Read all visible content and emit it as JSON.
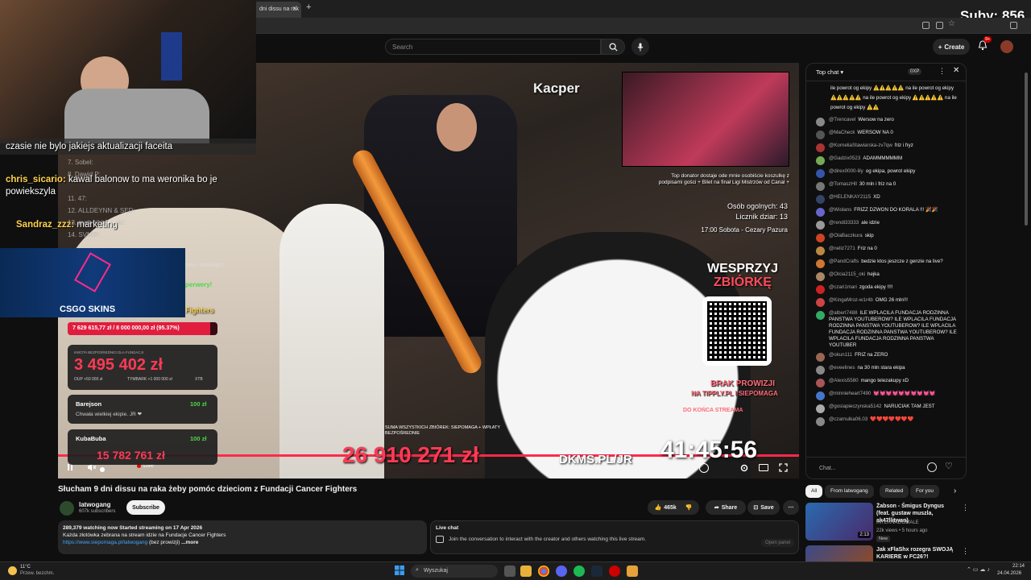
{
  "browser": {
    "tab_title": "dni dissu na rak",
    "new_tab": "+",
    "close_tab": "×"
  },
  "stream_overlay": {
    "subs_counter": "Suby: 856",
    "chat_line1": "czasie nie bylo jakiejs aktualizacji faceita",
    "chat2_user": "chris_sicario:",
    "chat2_msg": "kawal balonow to ma weronika bo je powiekszyla",
    "chat3_user": "Sandraz_zzz:",
    "chat3_msg": "marketing",
    "csgo_skins": "CSGO SKINS",
    "kacper_label": "Kacper",
    "fighters": "Fighters",
    "progress_text": "7 629 615,77 zł / 8 000 000,00 zł (95.37%)",
    "progress_fraction": 0.9537,
    "fund_label": "KWOTA BEZPOŚREDNIO DLA FUNDACJI",
    "fund_amount": "3 495 402 zł",
    "fund_sub1": "OUP +50 000 zł",
    "fund_sub2": "TYMBARK +1 000 000 zł",
    "fund_sub3": "XTB",
    "don1_user": "Barejson",
    "don1_amount": "100 zł",
    "don1_msg": "Chwała wielkiej ekipie. JR ❤",
    "don2_user": "KubaBuba",
    "don2_amount": "100 zł",
    "don2_total": "15 782 761 zł",
    "total_big": "26 910 271 zł",
    "total_caption": "SUMA WSZYSTKICH ZBIÓREK: SIEPOMAGA + WPŁATY BEZPOŚREDNIE",
    "dkms": "DKMS.PL/JR",
    "timer": "41:45:56",
    "timer_caption": "DO KOŃCA STREAMA",
    "top_donator": "Top donator dostaje ode mnie osobiście koszulkę z podpisami gości + Bilet na finał Ligi Mistrzów od Canal +",
    "people_total": "Osób ogolnych: 43",
    "gifts_counter": "Licznik dziar: 13",
    "saturday": "17:00 Sobota - Cezary Pazura",
    "wesprzyj": "WESPRZYJ",
    "zbiorke": "ZBIÓRKĘ",
    "brak_prowizji": "BRAK PROWIZJI",
    "tipply": "NA TIPPLY.PL I SIEPOMAGA",
    "ranks": [
      "7. Sobel:",
      "8. Dawid P:",
      "11. 47:",
      "12. ALLDEYNN & SED:",
      "13. matt gibbs + ski:",
      "14. SVMIR:"
    ],
    "live_label": "Live",
    "perwery": "perwery!",
    "rankingu": "celu i rankingu)"
  },
  "youtube": {
    "search_placeholder": "Search",
    "create_label": "Create",
    "notif_badge": "9+",
    "video_title": "Słucham 9 dni dissu na raka żeby pomóc dzieciom z Fundacji Cancer Fighters",
    "channel_name": "latwogang",
    "subscribers": "607k subscribers",
    "subscribe_label": "Subscribe",
    "likes": "465k",
    "share_label": "Share",
    "save_label": "Save",
    "desc_stats": "289,379 watching now  Started streaming on 17 Apr 2026",
    "desc_line1": "Każda złotówka zebrana na stream idzie na Fundacje Cancer Fighters",
    "desc_link": "https://www.siepomaga.pl/latwogang",
    "desc_rest": "(bez prowizji)",
    "desc_more": "...more",
    "live_chat_title": "Live chat",
    "live_chat_text": "Join the conversation to interact with the creator and others watching this live stream.",
    "open_panel": "Open panel"
  },
  "chat": {
    "header": "Top chat",
    "points": "0XP",
    "input_placeholder": "Chat...",
    "pinned_top": "ile powrot og ekipy ⚠️⚠️⚠️⚠️⚠️ na ile powrot og ekipy ⚠️⚠️⚠️⚠️⚠️ na ile powrot og ekipy ⚠️⚠️⚠️⚠️⚠️ na ile powrot og ekipy ⚠️⚠️",
    "messages": [
      {
        "user": "@Trencavel",
        "text": "Wersow na zero",
        "color": "#888"
      },
      {
        "user": "@MaCheck",
        "text": "WERSOW NA 0",
        "color": "#555"
      },
      {
        "user": "@KorneliaStawiarska-zv7qw",
        "text": "friz i fryz",
        "color": "#a33"
      },
      {
        "user": "@Gadzix0523",
        "text": "ADAMMMMMMM",
        "color": "#7a5"
      },
      {
        "user": "@direx0000-lily",
        "text": "og ekipa, powrot ekipy",
        "color": "#35a"
      },
      {
        "user": "@TomaszHll",
        "text": "30 mln i friz na 0",
        "color": "#777"
      },
      {
        "user": "@HELENKAY2115",
        "text": "XD",
        "color": "#346"
      },
      {
        "user": "@Wiolans",
        "text": "FRIZZ DZWON DO KORALA !!! 🎉🎉",
        "color": "#66c"
      },
      {
        "user": "@rendi33333",
        "text": "ale idzie",
        "color": "#999"
      },
      {
        "user": "@OlaBaczkura",
        "text": "skip",
        "color": "#c42"
      },
      {
        "user": "@neliz7271",
        "text": "Friz na 0",
        "color": "#b84"
      },
      {
        "user": "@PandCrafts",
        "text": "bedzie ktos jeszcze z genzie na live?",
        "color": "#c73"
      },
      {
        "user": "@Olcia2115_oki",
        "text": "hejka",
        "color": "#a86"
      },
      {
        "user": "@czari1mari",
        "text": "zgoda ekipy !!!!",
        "color": "#c22"
      },
      {
        "user": "@KingaMroz-w1r4b",
        "text": "OMG 26 mln!!!",
        "color": "#c44"
      },
      {
        "user": "@albert7488",
        "text": "ILE WPLACILA FUNDACJA RODZINNA PANSTWA YOUTUBEROW? ILE WPLACILA FUNDACJA RODZINNA PANSTWA YOUTUBEROW? ILE WPLACILA FUNDACJA RODZINNA PANSTWA YOUTUBEROW? ILE WPLACILA FUNDACJA RODZINNA PANSTWA YOUTUBER",
        "color": "#3a6"
      },
      {
        "user": "@okun111",
        "text": "FRIZ na ZERO",
        "color": "#965"
      },
      {
        "user": "@eveelines",
        "text": "na 30 mln stara ekipa",
        "color": "#888"
      },
      {
        "user": "@Alexis5580",
        "text": "mango telezakupy xD",
        "color": "#a55"
      },
      {
        "user": "@minnieheart7490",
        "text": "💓💓💓💓💓💓💓💓💓💓",
        "color": "#47c"
      },
      {
        "user": "@gosiapieczynska5142",
        "text": "NARUCIAK TAM JEST",
        "color": "#aaa"
      },
      {
        "user": "@czarnulka06.03",
        "text": "❤️❤️❤️❤️❤️❤️❤️",
        "color": "#888"
      }
    ]
  },
  "recommendations": {
    "chips": [
      "All",
      "From latwogang",
      "Related",
      "For you"
    ],
    "items": [
      {
        "title": "Żabson - Śmigus Dyngus (feat. gustaw muszla, ak47llitwan)",
        "channel": "INTERNAZIOMALE",
        "meta": "22k views • 5 hours ago",
        "badge": "New",
        "duration": "2:13"
      },
      {
        "title": "Jak xFlaShx rozegra SWOJĄ KARIERE w FC26?!",
        "channel": "",
        "meta": "",
        "badge": "",
        "duration": ""
      }
    ]
  },
  "taskbar": {
    "weather_temp": "11°C",
    "weather_desc": "Przew. bezchm.",
    "search_placeholder": "Wyszukaj",
    "time": "22:14",
    "date": "24.04.2026"
  }
}
